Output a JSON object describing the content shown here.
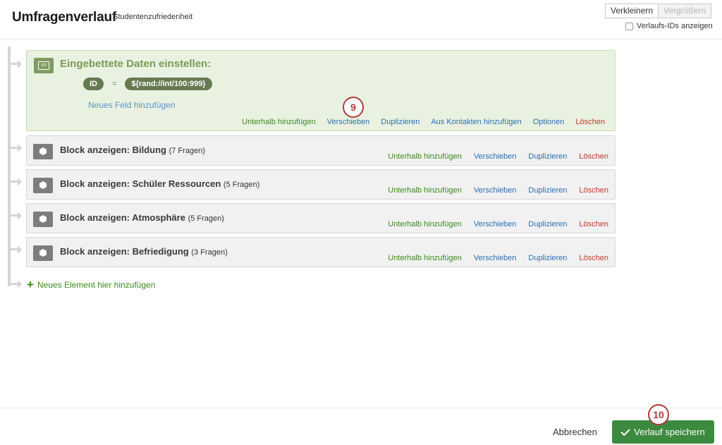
{
  "header": {
    "title": "Umfragenverlauf",
    "subtitle": "Studentenzufriedenheit",
    "zoom_out_label": "Verkleinern",
    "zoom_in_label": "Vergrößern",
    "show_ids_label": "Verlaufs-IDs anzeigen"
  },
  "embedded_data": {
    "icon_text": "ED",
    "title": "Eingebettete Daten einstellen:",
    "field_name": "ID",
    "equals": "=",
    "field_value": "${rand://int/100:999}",
    "add_field_label": "Neues Feld hinzufügen",
    "actions": {
      "add_below": "Unterhalb hinzufügen",
      "move": "Verschieben",
      "duplicate": "Duplizieren",
      "from_contacts": "Aus Kontakten hinzufügen",
      "options": "Optionen",
      "delete": "Löschen"
    }
  },
  "blocks": [
    {
      "title": "Block anzeigen: Bildung",
      "count": "(7 Fragen)"
    },
    {
      "title": "Block anzeigen: Schüler Ressourcen",
      "count": "(5 Fragen)"
    },
    {
      "title": "Block anzeigen: Atmosphäre",
      "count": "(5 Fragen)"
    },
    {
      "title": "Block anzeigen: Befriedigung",
      "count": "(3 Fragen)"
    }
  ],
  "block_actions": {
    "add_below": "Unterhalb hinzufügen",
    "move": "Verschieben",
    "duplicate": "Duplizieren",
    "delete": "Löschen"
  },
  "add_element_label": "Neues Element hier hinzufügen",
  "step_markers": {
    "first": "9",
    "second": "10"
  },
  "footer": {
    "cancel_label": "Abbrechen",
    "save_label": "Verlauf speichern"
  },
  "colors": {
    "embedded_bg": "#e9f2e0",
    "green_action": "#3c8a1e",
    "blue_action": "#2a6fb5",
    "red_action": "#c0392b",
    "save_button": "#3c8a3e"
  }
}
